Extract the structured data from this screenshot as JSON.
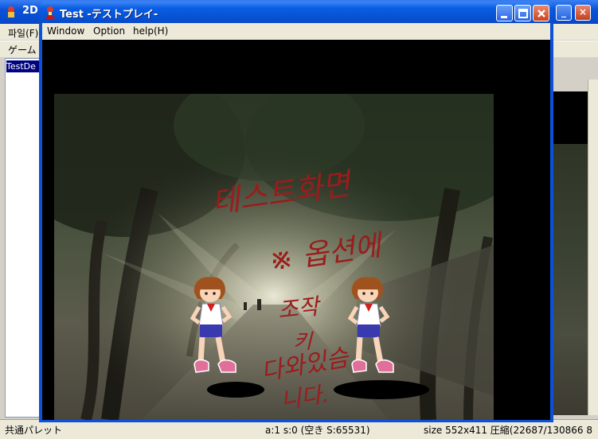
{
  "background_window": {
    "title": "2D",
    "menu_text": "파일(F)",
    "toolbar_text": "ゲーム",
    "list_item": "TestDe",
    "status": {
      "left": "共通パレット",
      "middle": "a:1 s:0 (空き S:65531)",
      "right": "size 552x411 圧縮(22687/130866 8"
    }
  },
  "test_window": {
    "title": "Test -テストプレイ-",
    "menu": [
      {
        "label": "Window"
      },
      {
        "label": "Option"
      },
      {
        "label": "help(H)"
      }
    ]
  },
  "stage": {
    "handwriting_lines": [
      "테스트화면",
      "※ 옵션에",
      "조작",
      "키",
      "다와있슴",
      "니다."
    ],
    "characters": [
      "left-fighter",
      "right-fighter"
    ],
    "colors": {
      "handwriting": "#9a1c1c",
      "shirt": "#ffffff",
      "shorts": "#3a3ab0",
      "hair": "#a0521e",
      "shoes": "#e0709a"
    }
  },
  "icons": {
    "app": "character-icon",
    "minimize": "minimize-icon",
    "maximize": "maximize-icon",
    "close": "close-icon"
  }
}
